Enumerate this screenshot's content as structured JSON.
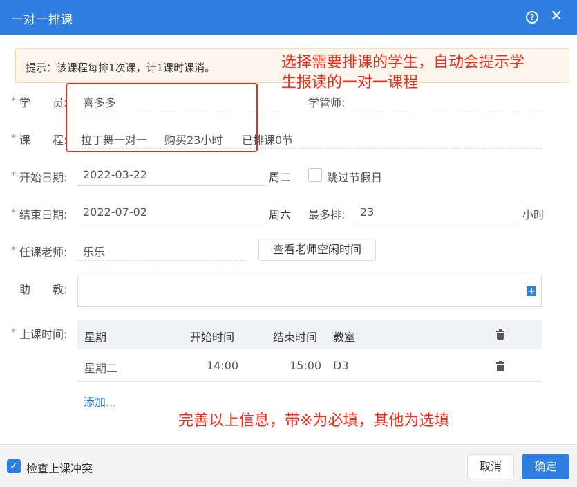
{
  "dialog": {
    "title": "一对一排课",
    "help_icon": "question-circle-icon",
    "close_icon": "close-icon"
  },
  "tip": {
    "text": "提示：该课程每排1次课，计1课时课消。"
  },
  "annotations": {
    "top": "选择需要排课的学生，自动会提示学生报读的一对一课程",
    "bottom": "完善以上信息，带※为必填，其他为选填"
  },
  "form": {
    "student": {
      "label": "学　　员:",
      "value": "喜多多"
    },
    "manager": {
      "label": "学管师:"
    },
    "course": {
      "label": "课　　程:",
      "name": "拉丁舞一对一",
      "bought": "购买23小时",
      "scheduled": "已排课0节"
    },
    "start_date": {
      "label": "开始日期:",
      "value": "2022-03-22",
      "weekday": "周二"
    },
    "skip_holiday": {
      "label": "跳过节假日",
      "checked": false
    },
    "end_date": {
      "label": "结束日期:",
      "value": "2022-07-02",
      "weekday": "周六"
    },
    "max_schedule": {
      "label": "最多排:",
      "value": "23",
      "unit": "小时"
    },
    "teacher": {
      "label": "任课老师:",
      "value": "乐乐",
      "button": "查看老师空闲时间"
    },
    "assistant": {
      "label": "助　　教:"
    },
    "class_time": {
      "label": "上课时间:"
    }
  },
  "table": {
    "headers": {
      "weekday": "星期",
      "start": "开始时间",
      "end": "结束时间",
      "room": "教室"
    },
    "rows": [
      {
        "weekday": "星期二",
        "start": "14:00",
        "end": "15:00",
        "room": "D3"
      }
    ],
    "add_link": "添加..."
  },
  "footer": {
    "check_conflict": {
      "label": "检查上课冲突",
      "checked": true
    },
    "cancel": "取消",
    "confirm": "确定"
  },
  "colors": {
    "primary": "#2f7ee2",
    "annotation": "#f52a1a",
    "required": "#f56c6c"
  }
}
